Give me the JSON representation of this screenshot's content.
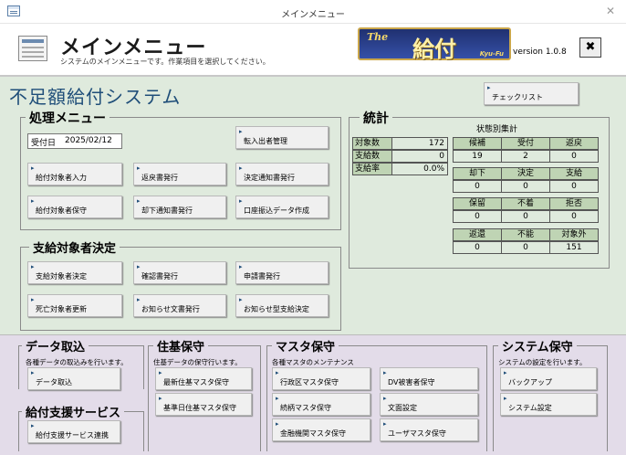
{
  "window": {
    "title": "メインメニュー"
  },
  "header": {
    "title": "メインメニュー",
    "subtitle": "システムのメインメニューです。作業項目を選択してください。",
    "logo": {
      "prefix": "The",
      "main": "給付",
      "suffix": "Kyu-Fu"
    },
    "version": "version 1.0.8",
    "close_label": "✖"
  },
  "system_title": "不足額給付システム",
  "check_list_label": "チェックリスト",
  "processing": {
    "title": "処理メニュー",
    "date_label": "受付日",
    "date_value": "2025/02/12",
    "buttons": [
      "転入出者管理",
      "給付対象者入力",
      "返戻書発行",
      "決定通知書発行",
      "給付対象者保守",
      "却下通知書発行",
      "口座振込データ作成"
    ]
  },
  "decision": {
    "title": "支給対象者決定",
    "buttons": [
      "支給対象者決定",
      "確認書発行",
      "申請書発行",
      "死亡対象者更新",
      "お知らせ文書発行",
      "お知らせ型支給決定"
    ]
  },
  "stats": {
    "title": "統計",
    "summary": [
      {
        "label": "対象数",
        "value": "172"
      },
      {
        "label": "支給数",
        "value": "0"
      },
      {
        "label": "支給率",
        "value": "0.0%"
      }
    ],
    "status_title": "状態別集計",
    "status": [
      {
        "label": "候補",
        "value": "19"
      },
      {
        "label": "受付",
        "value": "2"
      },
      {
        "label": "返戻",
        "value": "0"
      },
      {
        "label": "却下",
        "value": "0"
      },
      {
        "label": "決定",
        "value": "0"
      },
      {
        "label": "支給",
        "value": "0"
      },
      {
        "label": "保留",
        "value": "0"
      },
      {
        "label": "不着",
        "value": "0"
      },
      {
        "label": "拒否",
        "value": "0"
      },
      {
        "label": "返還",
        "value": "0"
      },
      {
        "label": "不能",
        "value": "0"
      },
      {
        "label": "対象外",
        "value": "151"
      }
    ]
  },
  "data_import": {
    "title": "データ取込",
    "desc": "各種データの取込みを行います。",
    "buttons": [
      "データ取込"
    ]
  },
  "support": {
    "title": "給付支援サービス",
    "buttons": [
      "給付支援サービス連携"
    ]
  },
  "resident": {
    "title": "住基保守",
    "desc": "住基データの保守行います。",
    "buttons": [
      "最新住基マスタ保守",
      "基準日住基マスタ保守"
    ]
  },
  "master": {
    "title": "マスタ保守",
    "desc": "各種マスタのメンテナンス",
    "buttons": [
      "行政区マスタ保守",
      "DV被害者保守",
      "続柄マスタ保守",
      "文面設定",
      "金融機関マスタ保守",
      "ユーザマスタ保守"
    ]
  },
  "sysmaint": {
    "title": "システム保守",
    "desc": "システムの設定を行います。",
    "buttons": [
      "バックアップ",
      "システム設定"
    ]
  }
}
